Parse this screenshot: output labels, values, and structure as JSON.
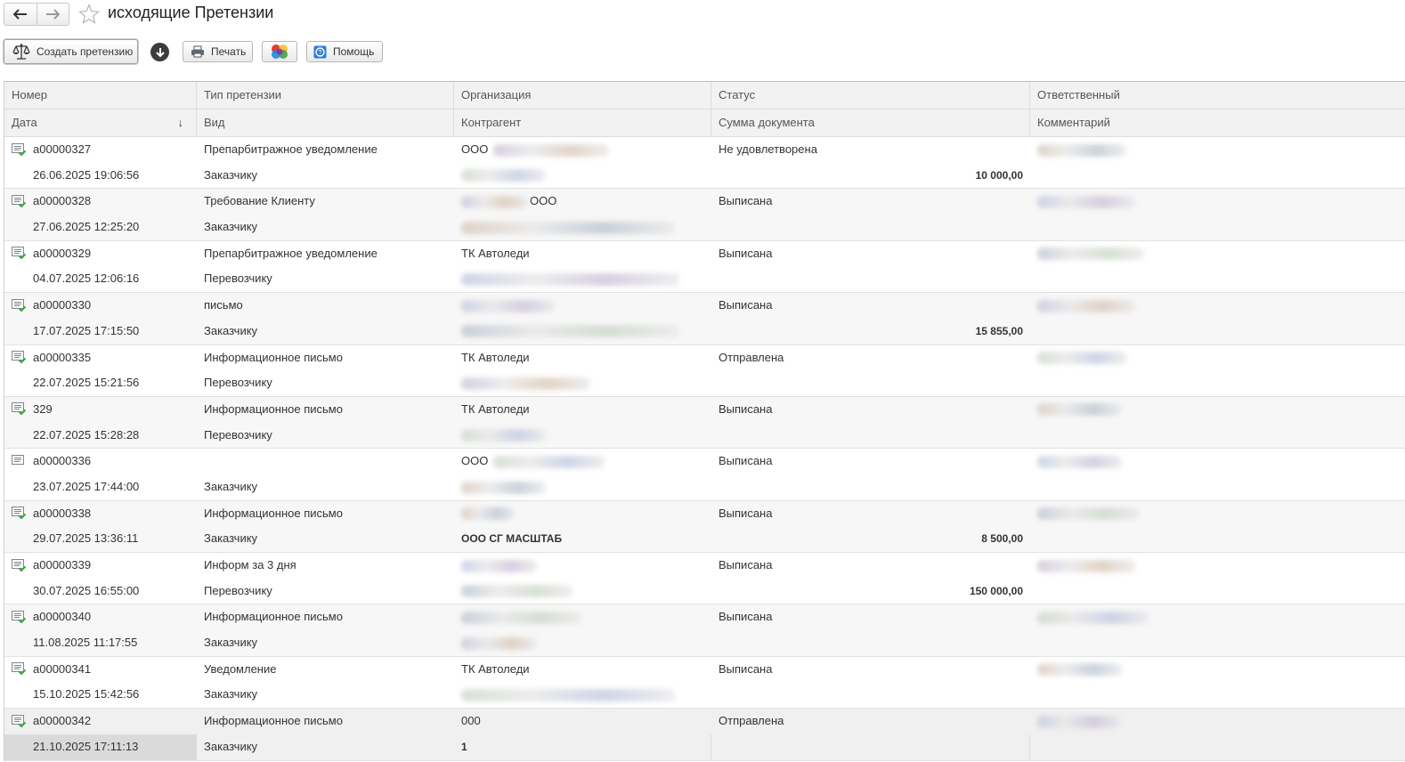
{
  "window": {
    "title": "исходящие Претензии"
  },
  "toolbar": {
    "create_label": "Создать претензию",
    "print_label": "Печать",
    "help_label": "Помощь"
  },
  "columns": {
    "row1": [
      "Номер",
      "Тип претензии",
      "Организация",
      "Статус",
      "Ответственный"
    ],
    "row2": [
      "Дата",
      "Вид",
      "Контрагент",
      "Сумма документа",
      "Комментарий"
    ]
  },
  "colors": {
    "accent": "#2a7fd4",
    "doc_icon_green": "#3aa53a"
  },
  "rows": [
    {
      "num": "а00000327",
      "date": "26.06.2025 19:06:56",
      "type": "Препарбитражное уведомление",
      "kind": "Заказчику",
      "org": "ООО",
      "contractor": "",
      "status": "Не удовлетворена",
      "amount": "10 000,00"
    },
    {
      "num": "а00000328",
      "date": "27.06.2025 12:25:20",
      "type": "Требование Клиенту",
      "kind": "Заказчику",
      "org": "ООО",
      "contractor": "",
      "status": "Выписана",
      "amount": ""
    },
    {
      "num": "а00000329",
      "date": "04.07.2025 12:06:16",
      "type": "Препарбитражное уведомление",
      "kind": "Перевозчику",
      "org": "ТК Автоледи",
      "contractor": "",
      "status": "Выписана",
      "amount": ""
    },
    {
      "num": "а00000330",
      "date": "17.07.2025 17:15:50",
      "type": "письмо",
      "kind": "Заказчику",
      "org": "",
      "contractor": "",
      "status": "Выписана",
      "amount": "15 855,00"
    },
    {
      "num": "а00000335",
      "date": "22.07.2025 15:21:56",
      "type": "Информационное письмо",
      "kind": "Перевозчику",
      "org": "ТК Автоледи",
      "contractor": "",
      "status": "Отправлена",
      "amount": ""
    },
    {
      "num": "329",
      "date": "22.07.2025 15:28:28",
      "type": "Информационное письмо",
      "kind": "Перевозчику",
      "org": "ТК Автоледи",
      "contractor": "",
      "status": "Выписана",
      "amount": ""
    },
    {
      "num": "а00000336",
      "date": "23.07.2025 17:44:00",
      "type": "",
      "kind": "Заказчику",
      "org": "ООО",
      "contractor": "",
      "status": "Выписана",
      "amount": ""
    },
    {
      "num": "а00000338",
      "date": "29.07.2025 13:36:11",
      "type": "Информационное письмо",
      "kind": "Заказчику",
      "org": "",
      "contractor": "ООО СГ МАСШТАБ",
      "status": "Выписана",
      "amount": "8 500,00"
    },
    {
      "num": "а00000339",
      "date": "30.07.2025 16:55:00",
      "type": "Информ за 3 дня",
      "kind": "Перевозчику",
      "org": "",
      "contractor": "",
      "status": "Выписана",
      "amount": "150 000,00"
    },
    {
      "num": "а00000340",
      "date": "11.08.2025 11:17:55",
      "type": "Информационное письмо",
      "kind": "Заказчику",
      "org": "",
      "contractor": "",
      "status": "Выписана",
      "amount": ""
    },
    {
      "num": "а00000341",
      "date": "15.10.2025 15:42:56",
      "type": "Уведомление",
      "kind": "Заказчику",
      "org": "ТК Автоледи",
      "contractor": "",
      "status": "Выписана",
      "amount": ""
    },
    {
      "num": "а00000342",
      "date": "21.10.2025 17:11:13",
      "type": "Информационное письмо",
      "kind": "Заказчику",
      "org": "000",
      "contractor": "1",
      "status": "Отправлена",
      "amount": ""
    }
  ]
}
